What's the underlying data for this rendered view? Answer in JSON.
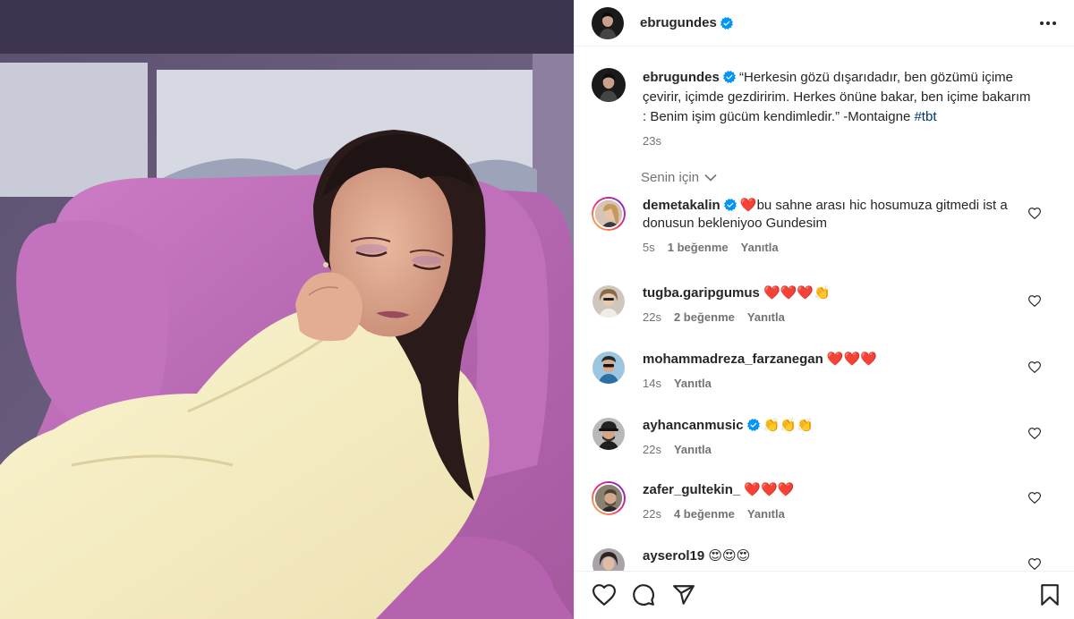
{
  "post": {
    "author": "ebrugundes",
    "author_verified": true,
    "caption": "“Herkesin gözü dışarıdadır, ben gözümü içime çevirir, içimde gezdiririm. Herkes önüne bakar, ben içime bakarım : Benim işim gücüm kendimledir.” -Montaigne",
    "hashtag": "#tbt",
    "time": "23s"
  },
  "sort_label": "Senin için",
  "comments": [
    {
      "username": "demetakalin",
      "verified": true,
      "text": "❤️bu sahne arası hic hosumuza gitmedi ist a donusun bekleniyoo Gundesim",
      "time": "5s",
      "likes": "1 beğenme",
      "reply": "Yanıtla",
      "story": true
    },
    {
      "username": "tugba.garipgumus",
      "verified": false,
      "text": "❤️❤️❤️👏",
      "time": "22s",
      "likes": "2 beğenme",
      "reply": "Yanıtla",
      "story": false
    },
    {
      "username": "mohammadreza_farzanegan",
      "verified": false,
      "text": "❤️❤️❤️",
      "time": "14s",
      "likes": "",
      "reply": "Yanıtla",
      "story": false
    },
    {
      "username": "ayhancanmusic",
      "verified": true,
      "text": "👏👏👏",
      "time": "22s",
      "likes": "",
      "reply": "Yanıtla",
      "story": false
    },
    {
      "username": "zafer_gultekin_",
      "verified": false,
      "text": "❤️❤️❤️",
      "time": "22s",
      "likes": "4 beğenme",
      "reply": "Yanıtla",
      "story": true
    },
    {
      "username": "ayserol19",
      "verified": false,
      "text": "😍😍😍",
      "time": "",
      "likes": "",
      "reply": "",
      "story": false
    }
  ],
  "icons": {
    "more": "more-horizontal-icon",
    "like": "heart-icon",
    "comment": "comment-bubble-icon",
    "share": "paper-plane-icon",
    "save": "bookmark-icon",
    "verified": "verified-badge-icon",
    "chevron": "chevron-down-icon"
  },
  "colors": {
    "verified_blue": "#0095f6",
    "heart_red": "#ed4956",
    "text_primary": "#262626",
    "text_secondary": "#737373",
    "hashtag": "#00376b"
  }
}
